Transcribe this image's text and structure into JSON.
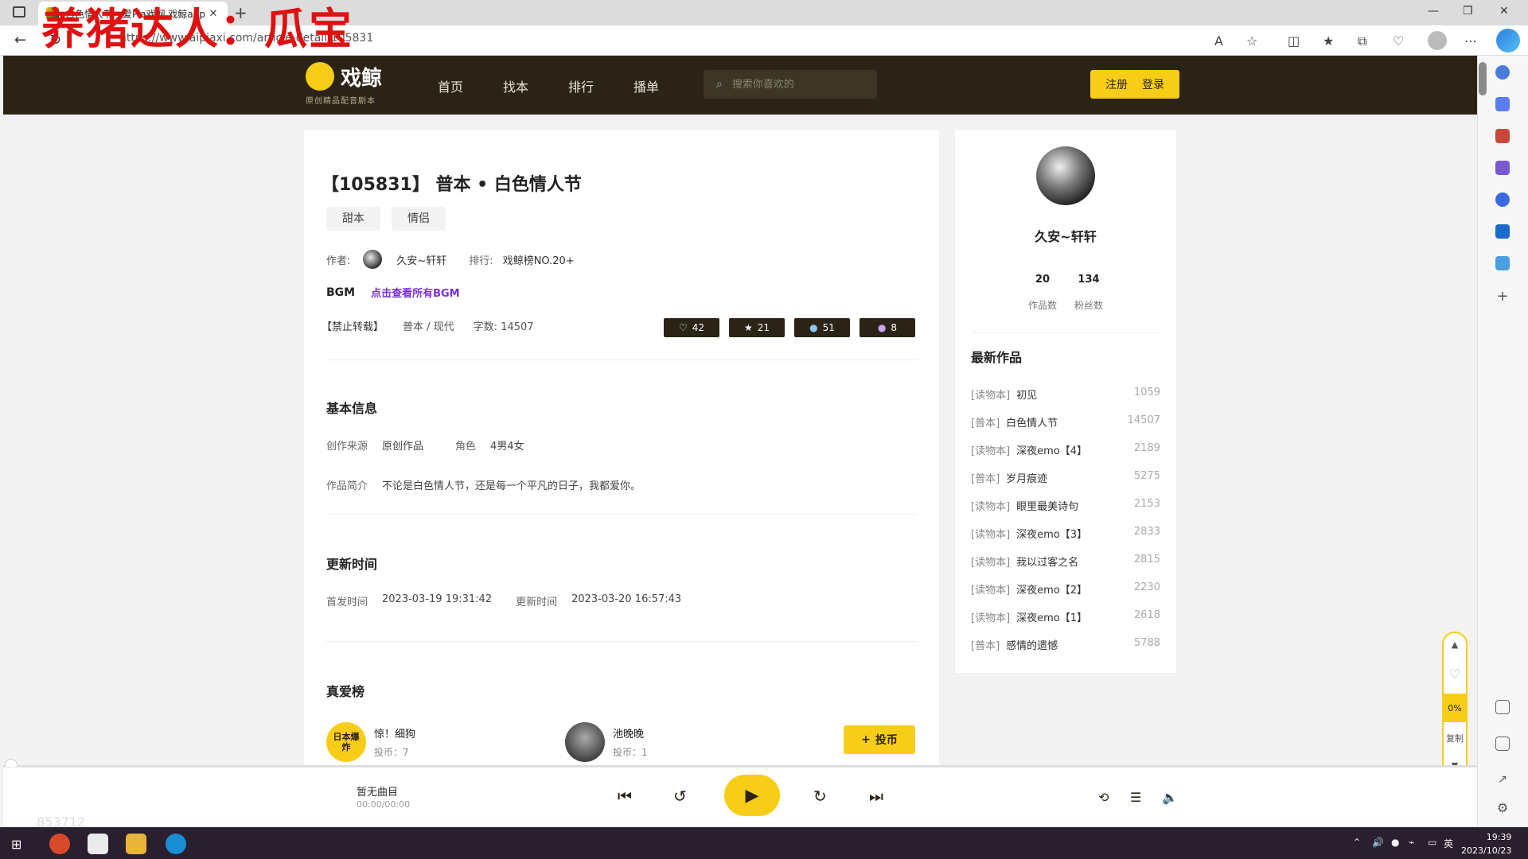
{
  "browser": {
    "tab_title": "白色情人节 - 爱Pia戏网,戏鲸app",
    "url": "https://www.aipiaxi.com/article-detail/105831",
    "new_tab": "+",
    "close_tab": "✕"
  },
  "overlay": {
    "watermark": "养猪达人：瓜宝",
    "bottom_number": "853712"
  },
  "site": {
    "logo_text": "戏鲸",
    "logo_sub": "原创精品配音剧本",
    "nav": [
      "首页",
      "找本",
      "排行",
      "播单"
    ],
    "search_placeholder": "搜索你喜欢的",
    "register": "注册",
    "login": "登录"
  },
  "article": {
    "title": "【105831】 普本 • 白色情人节",
    "tags": [
      "甜本",
      "情侣"
    ],
    "author_label": "作者:",
    "author": "久安~轩轩",
    "rank_label": "排行:",
    "rank": "戏鲸榜NO.20+",
    "bgm_label": "BGM",
    "bgm_link": "点击查看所有BGM",
    "no_repost": "【禁止转载】",
    "genre": "普本 / 现代",
    "word_count": "字数: 14507",
    "stats": {
      "likes": "42",
      "stars": "21",
      "comments": "51",
      "shares": "8"
    },
    "basic_info_title": "基本信息",
    "source_label": "创作来源",
    "source": "原创作品",
    "roles_label": "角色",
    "roles": "4男4女",
    "intro_label": "作品简介",
    "intro": "不论是白色情人节，还是每一个平凡的日子，我都爱你。",
    "update_title": "更新时间",
    "first_label": "首发时间",
    "first_time": "2023-03-19 19:31:42",
    "update_label": "更新时间",
    "update_time": "2023-03-20 16:57:43",
    "love_title": "真爱榜",
    "supporters": [
      {
        "name": "惊！细狗",
        "coins": "投币：7",
        "badge": "日本爆炸"
      },
      {
        "name": "池晚晚",
        "coins": "投币：1"
      }
    ],
    "donate": "投币"
  },
  "author_card": {
    "name": "久安~轩轩",
    "works_count": "20",
    "works_label": "作品数",
    "fans_count": "134",
    "fans_label": "粉丝数",
    "latest_title": "最新作品",
    "works": [
      {
        "cat": "[读物本]",
        "title": "初见",
        "count": "1059"
      },
      {
        "cat": "[普本]",
        "title": "白色情人节",
        "count": "14507"
      },
      {
        "cat": "[读物本]",
        "title": "深夜emo【4】",
        "count": "2189"
      },
      {
        "cat": "[普本]",
        "title": "岁月痕迹",
        "count": "5275"
      },
      {
        "cat": "[读物本]",
        "title": "眼里最美诗句",
        "count": "2153"
      },
      {
        "cat": "[读物本]",
        "title": "深夜emo【3】",
        "count": "2833"
      },
      {
        "cat": "[读物本]",
        "title": "我以过客之名",
        "count": "2815"
      },
      {
        "cat": "[读物本]",
        "title": "深夜emo【2】",
        "count": "2230"
      },
      {
        "cat": "[读物本]",
        "title": "深夜emo【1】",
        "count": "2618"
      },
      {
        "cat": "[普本]",
        "title": "感情的遗憾",
        "count": "5788"
      }
    ]
  },
  "float_bar": {
    "percent": "0%",
    "copy": "复制"
  },
  "player": {
    "track": "暂无曲目",
    "time": "00:00/00:00"
  },
  "taskbar": {
    "time": "19:39",
    "date": "2023/10/23",
    "ime": "英"
  }
}
